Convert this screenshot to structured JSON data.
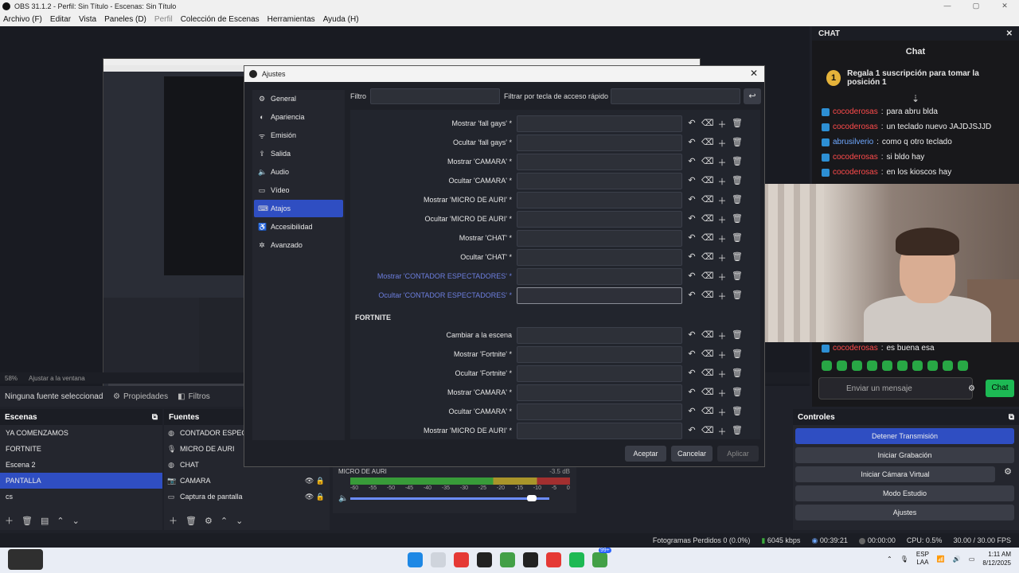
{
  "window": {
    "title": "OBS 31.1.2 - Perfil: Sin Título - Escenas: Sin Título",
    "controls": [
      "—",
      "▢",
      "✕"
    ]
  },
  "menu": [
    "Archivo (F)",
    "Editar",
    "Vista",
    "Paneles (D)",
    "Perfil",
    "Colección de Escenas",
    "Herramientas",
    "Ayuda (H)"
  ],
  "zoom": {
    "percent": "58%",
    "fit_label": "Ajustar a la ventana"
  },
  "props_bar": {
    "no_source": "Ninguna fuente seleccionad",
    "properties": "Propiedades",
    "filters": "Filtros"
  },
  "scenes": {
    "title": "Escenas",
    "items": [
      "YA COMENZAMOS",
      "FORTNITE",
      "Escena 2",
      "PANTALLA",
      "cs"
    ],
    "active_index": 3
  },
  "sources": {
    "title": "Fuentes",
    "items": [
      {
        "label": "CONTADOR ESPECT",
        "icon": "globe-icon"
      },
      {
        "label": "MICRO DE AURI",
        "icon": "microphone-icon"
      },
      {
        "label": "CHAT",
        "icon": "globe-icon"
      },
      {
        "label": "CAMARA",
        "icon": "camera-icon"
      },
      {
        "label": "Captura de pantalla",
        "icon": "monitor-icon"
      }
    ]
  },
  "mixer": {
    "name": "MICRO DE AURI",
    "db": "-3.5 dB",
    "scale": [
      "-60",
      "-55",
      "-50",
      "-45",
      "-40",
      "-35",
      "-30",
      "-25",
      "-20",
      "-15",
      "-10",
      "-5",
      "0"
    ],
    "volume": 0.9
  },
  "controls": {
    "title": "Controles",
    "buttons": [
      "Detener Transmisión",
      "Iniciar Grabación",
      "Iniciar Cámara Virtual",
      "Modo Estudio",
      "Ajustes"
    ]
  },
  "chat": {
    "dock_title": "CHAT",
    "title": "Chat",
    "sub_rank": "1",
    "sub_text": "Regala 1 suscripción para tomar la posición 1",
    "messages": [
      {
        "user": "cocoderosas",
        "text": "para abru blda"
      },
      {
        "user": "cocoderosas",
        "text": "un teclado nuevo JAJDJSJJD"
      },
      {
        "user": "abrusilverio",
        "text": "como q otro teclado"
      },
      {
        "user": "cocoderosas",
        "text": "si bldo hay"
      },
      {
        "user": "cocoderosas",
        "text": "en los kioscos hay"
      }
    ],
    "last_message": {
      "user": "cocoderosas",
      "text": "es buena esa"
    },
    "input_placeholder": "Enviar un mensaje",
    "send_label": "Chat"
  },
  "dialog": {
    "title": "Ajustes",
    "sidebar": [
      {
        "label": "General",
        "icon": "gear-icon"
      },
      {
        "label": "Apariencia",
        "icon": "palette-icon"
      },
      {
        "label": "Emisión",
        "icon": "antenna-icon"
      },
      {
        "label": "Salida",
        "icon": "output-icon"
      },
      {
        "label": "Audio",
        "icon": "speaker-icon"
      },
      {
        "label": "Vídeo",
        "icon": "monitor-icon"
      },
      {
        "label": "Atajos",
        "icon": "keyboard-icon"
      },
      {
        "label": "Accesibilidad",
        "icon": "accessibility-icon"
      },
      {
        "label": "Avanzado",
        "icon": "wrench-icon"
      }
    ],
    "active_index": 6,
    "filter_label": "Filtro",
    "filter_hotkey_label": "Filtrar por tecla de acceso rápido",
    "hotkeys": [
      {
        "label": "Mostrar 'fall gays' *"
      },
      {
        "label": "Ocultar 'fall gays' *"
      },
      {
        "label": "Mostrar 'CAMARA' *"
      },
      {
        "label": "Ocultar 'CAMARA' *"
      },
      {
        "label": "Mostrar 'MICRO DE AURI' *"
      },
      {
        "label": "Ocultar 'MICRO DE AURI' *"
      },
      {
        "label": "Mostrar 'CHAT' *"
      },
      {
        "label": "Ocultar 'CHAT' *"
      },
      {
        "label": "Mostrar 'CONTADOR ESPECTADORES' *"
      },
      {
        "label": "Ocultar 'CONTADOR ESPECTADORES' *"
      }
    ],
    "section2_title": "FORTNITE",
    "hotkeys2": [
      {
        "label": "Cambiar a la escena"
      },
      {
        "label": "Mostrar 'Fortnite' *"
      },
      {
        "label": "Ocultar 'Fortnite' *"
      },
      {
        "label": "Mostrar 'CAMARA' *"
      },
      {
        "label": "Ocultar 'CAMARA' *"
      },
      {
        "label": "Mostrar 'MICRO DE AURI' *"
      }
    ],
    "buttons": {
      "accept": "Aceptar",
      "cancel": "Cancelar",
      "apply": "Aplicar"
    }
  },
  "status": {
    "dropped": "Fotogramas Perdidos 0 (0.0%)",
    "kbps": "6045 kbps",
    "live_time": "00:39:21",
    "rec_time": "00:00:00",
    "cpu": "CPU: 0.5%",
    "fps": "30.00 / 30.00 FPS"
  },
  "taskbar": {
    "lang": "ESP",
    "layout": "LAA",
    "time": "1:11 AM",
    "date": "8/12/2025",
    "badge": "99+"
  },
  "colors": {
    "accent": "#2f4ec2",
    "chat_green": "#1db954",
    "highlight_label": "#6d7fe0"
  }
}
